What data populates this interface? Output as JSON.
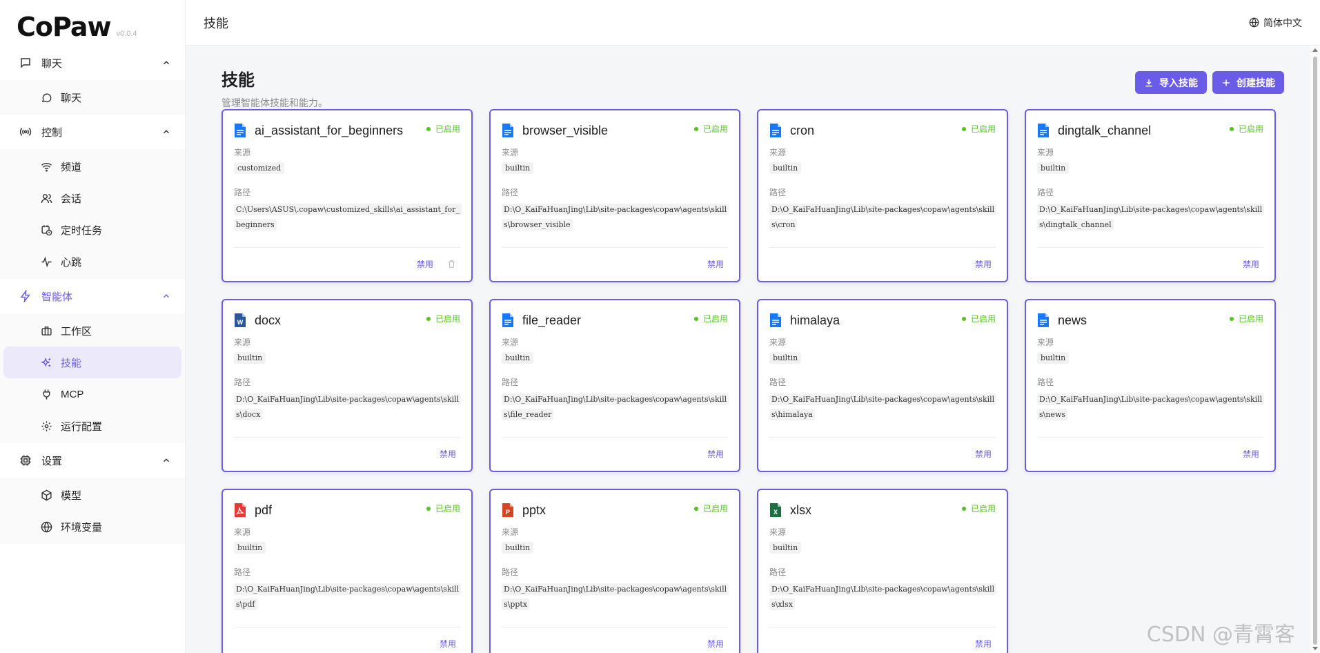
{
  "app": {
    "logo": "CoPaw",
    "version": "v0.0.4"
  },
  "sidebar": {
    "groups": [
      {
        "label": "聊天",
        "items": [
          {
            "label": "聊天"
          }
        ]
      },
      {
        "label": "控制",
        "items": [
          {
            "label": "频道"
          },
          {
            "label": "会话"
          },
          {
            "label": "定时任务"
          },
          {
            "label": "心跳"
          }
        ]
      },
      {
        "label": "智能体",
        "items": [
          {
            "label": "工作区"
          },
          {
            "label": "技能"
          },
          {
            "label": "MCP"
          },
          {
            "label": "运行配置"
          }
        ]
      },
      {
        "label": "设置",
        "items": [
          {
            "label": "模型"
          },
          {
            "label": "环境变量"
          }
        ]
      }
    ]
  },
  "header": {
    "title": "技能",
    "language": "简体中文"
  },
  "page": {
    "title": "技能",
    "subtitle": "管理智能体技能和能力。",
    "import_button": "导入技能",
    "create_button": "创建技能"
  },
  "card_labels": {
    "source": "来源",
    "path": "路径",
    "status": "已启用",
    "disable": "禁用"
  },
  "skills": [
    {
      "name": "ai_assistant_for_beginners",
      "source": "customized",
      "path": "C:\\Users\\ASUS\\.copaw\\customized_skills\\ai_assistant_for_beginners",
      "icon": "doc-icon"
    },
    {
      "name": "browser_visible",
      "source": "builtin",
      "path": "D:\\O_KaiFaHuanJing\\Lib\\site-packages\\copaw\\agents\\skills\\browser_visible",
      "icon": "doc-icon"
    },
    {
      "name": "cron",
      "source": "builtin",
      "path": "D:\\O_KaiFaHuanJing\\Lib\\site-packages\\copaw\\agents\\skills\\cron",
      "icon": "doc-icon"
    },
    {
      "name": "dingtalk_channel",
      "source": "builtin",
      "path": "D:\\O_KaiFaHuanJing\\Lib\\site-packages\\copaw\\agents\\skills\\dingtalk_channel",
      "icon": "doc-icon"
    },
    {
      "name": "docx",
      "source": "builtin",
      "path": "D:\\O_KaiFaHuanJing\\Lib\\site-packages\\copaw\\agents\\skills\\docx",
      "icon": "word-icon"
    },
    {
      "name": "file_reader",
      "source": "builtin",
      "path": "D:\\O_KaiFaHuanJing\\Lib\\site-packages\\copaw\\agents\\skills\\file_reader",
      "icon": "doc-icon"
    },
    {
      "name": "himalaya",
      "source": "builtin",
      "path": "D:\\O_KaiFaHuanJing\\Lib\\site-packages\\copaw\\agents\\skills\\himalaya",
      "icon": "doc-icon"
    },
    {
      "name": "news",
      "source": "builtin",
      "path": "D:\\O_KaiFaHuanJing\\Lib\\site-packages\\copaw\\agents\\skills\\news",
      "icon": "doc-icon"
    },
    {
      "name": "pdf",
      "source": "builtin",
      "path": "D:\\O_KaiFaHuanJing\\Lib\\site-packages\\copaw\\agents\\skills\\pdf",
      "icon": "pdf-icon"
    },
    {
      "name": "pptx",
      "source": "builtin",
      "path": "D:\\O_KaiFaHuanJing\\Lib\\site-packages\\copaw\\agents\\skills\\pptx",
      "icon": "ppt-icon"
    },
    {
      "name": "xlsx",
      "source": "builtin",
      "path": "D:\\O_KaiFaHuanJing\\Lib\\site-packages\\copaw\\agents\\skills\\xlsx",
      "icon": "excel-icon"
    }
  ],
  "colors": {
    "accent": "#6b5ce7",
    "enabled": "#52c41a",
    "doc": "#1677ff",
    "word": "#2b579a",
    "pdf": "#e53935",
    "ppt": "#d24726",
    "excel": "#1d6f42"
  },
  "watermark": "CSDN @青霄客"
}
